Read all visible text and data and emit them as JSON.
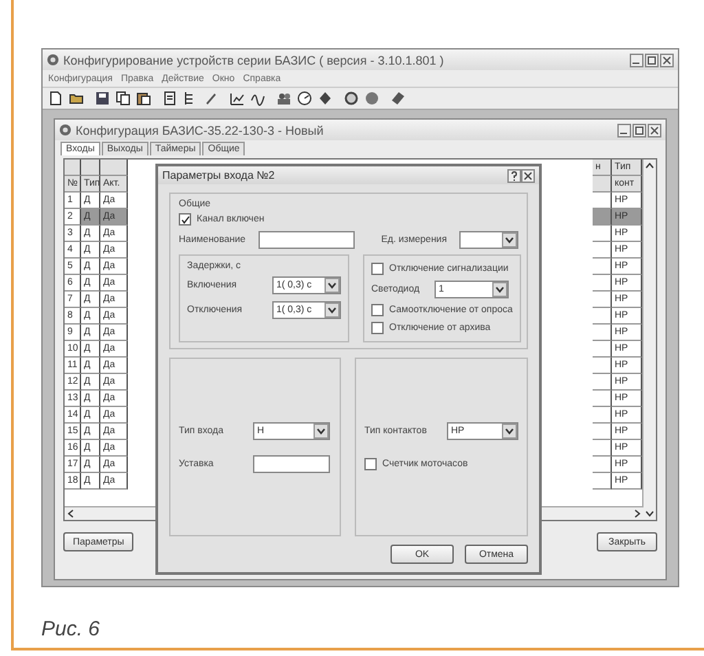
{
  "window": {
    "title": "Конфигурирование устройств серии БАЗИС ( версия - 3.10.1.801 )"
  },
  "menu": [
    "Конфигурация",
    "Правка",
    "Действие",
    "Окно",
    "Справка"
  ],
  "child": {
    "title": "Конфигурация БАЗИС-35.22-130-3 - Новый",
    "tabs": [
      {
        "label": "Входы",
        "selected": true
      },
      {
        "label": "Выходы",
        "selected": false
      },
      {
        "label": "Таймеры",
        "selected": false
      },
      {
        "label": "Общие",
        "selected": false
      }
    ],
    "grid": {
      "columns": [
        "№",
        "Тип",
        "Акт."
      ],
      "right_header": [
        "н",
        "Тип",
        "конт"
      ],
      "rows": [
        {
          "num": "1",
          "type": "Д",
          "act": "Да",
          "contact": "НР",
          "selected": false
        },
        {
          "num": "2",
          "type": "Д",
          "act": "Да",
          "contact": "НР",
          "selected": true
        },
        {
          "num": "3",
          "type": "Д",
          "act": "Да",
          "contact": "НР",
          "selected": false
        },
        {
          "num": "4",
          "type": "Д",
          "act": "Да",
          "contact": "НР",
          "selected": false
        },
        {
          "num": "5",
          "type": "Д",
          "act": "Да",
          "contact": "НР",
          "selected": false
        },
        {
          "num": "6",
          "type": "Д",
          "act": "Да",
          "contact": "НР",
          "selected": false
        },
        {
          "num": "7",
          "type": "Д",
          "act": "Да",
          "contact": "НР",
          "selected": false
        },
        {
          "num": "8",
          "type": "Д",
          "act": "Да",
          "contact": "НР",
          "selected": false
        },
        {
          "num": "9",
          "type": "Д",
          "act": "Да",
          "contact": "НР",
          "selected": false
        },
        {
          "num": "10",
          "type": "Д",
          "act": "Да",
          "contact": "НР",
          "selected": false
        },
        {
          "num": "11",
          "type": "Д",
          "act": "Да",
          "contact": "НР",
          "selected": false
        },
        {
          "num": "12",
          "type": "Д",
          "act": "Да",
          "contact": "НР",
          "selected": false
        },
        {
          "num": "13",
          "type": "Д",
          "act": "Да",
          "contact": "НР",
          "selected": false
        },
        {
          "num": "14",
          "type": "Д",
          "act": "Да",
          "contact": "НР",
          "selected": false
        },
        {
          "num": "15",
          "type": "Д",
          "act": "Да",
          "contact": "НР",
          "selected": false
        },
        {
          "num": "16",
          "type": "Д",
          "act": "Да",
          "contact": "НР",
          "selected": false
        },
        {
          "num": "17",
          "type": "Д",
          "act": "Да",
          "contact": "НР",
          "selected": false
        },
        {
          "num": "18",
          "type": "Д",
          "act": "Да",
          "contact": "НР",
          "selected": false
        }
      ]
    },
    "buttons": [
      "Параметры",
      "Закрыть"
    ]
  },
  "dialog": {
    "title": "Параметры входа №2",
    "general": {
      "legend": "Общие",
      "enabled": {
        "label": "Канал включен",
        "checked": true
      },
      "name_label": "Наименование",
      "unit_label": "Ед. измерения"
    },
    "delays": {
      "legend": "Задержки, с",
      "rows": [
        {
          "label": "Включения",
          "value": "1( 0,3) с"
        },
        {
          "label": "Отключения",
          "value": "1( 0,3) с"
        }
      ]
    },
    "alarm": {
      "legend": {
        "label": "Отключение сигнализации",
        "checked": false
      },
      "led_label": "Светодиод",
      "led_value": "1",
      "checks": [
        {
          "label": "Самоотключение от опроса",
          "checked": false
        },
        {
          "label": "Отключение от архива",
          "checked": false
        }
      ]
    },
    "input_type": {
      "label": "Тип входа",
      "value": "Н"
    },
    "setpoint_label": "Уставка",
    "contact_type": {
      "label": "Тип контактов",
      "value": "НР"
    },
    "hour_meter": {
      "label": "Счетчик моточасов",
      "checked": false
    },
    "buttons": [
      "OK",
      "Отмена"
    ]
  },
  "caption": "Рис. 6"
}
